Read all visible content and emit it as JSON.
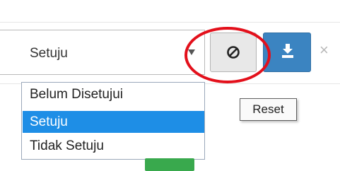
{
  "filter": {
    "selected_value": "Setuju",
    "options": [
      "Belum Disetujui",
      "Setuju",
      "Tidak Setuju"
    ],
    "highlighted_option": "Setuju"
  },
  "buttons": {
    "reset_icon": "ban-icon",
    "download_icon": "download-icon",
    "clear_symbol": "×"
  },
  "tooltip": {
    "text": "Reset"
  },
  "colors": {
    "highlight": "#1e8ee6",
    "download_button": "#3b84c1",
    "annotation_circle": "#e3101b",
    "badge": "#39a94d"
  }
}
